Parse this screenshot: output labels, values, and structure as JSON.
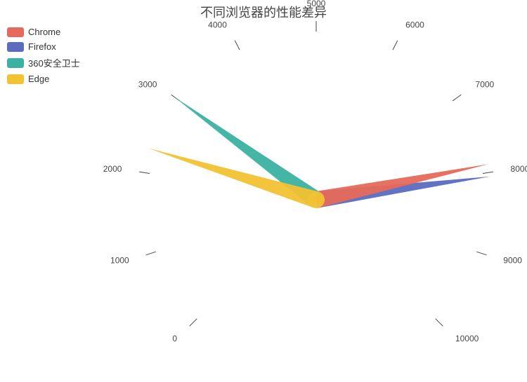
{
  "chart_data": {
    "type": "other",
    "title": "不同浏览器的性能差异",
    "gauge": {
      "min": 0,
      "max": 10000,
      "ticks": [
        0,
        1000,
        2000,
        3000,
        4000,
        5000,
        6000,
        7000,
        8000,
        9000,
        10000
      ],
      "startAngle": 225,
      "endAngle": -45
    },
    "series": [
      {
        "name": "Chrome",
        "value": 7900,
        "color": "#e6695b"
      },
      {
        "name": "Firefox",
        "value": 8050,
        "color": "#5b6bc0"
      },
      {
        "name": "360安全卫士",
        "value": 3000,
        "color": "#3bb2a1"
      },
      {
        "name": "Edge",
        "value": 2300,
        "color": "#f1c232"
      }
    ]
  },
  "legend": {
    "items": [
      {
        "label": "Chrome",
        "color": "#e6695b"
      },
      {
        "label": "Firefox",
        "color": "#5b6bc0"
      },
      {
        "label": "360安全卫士",
        "color": "#3bb2a1"
      },
      {
        "label": "Edge",
        "color": "#f1c232"
      }
    ]
  },
  "title": "不同浏览器的性能差异"
}
